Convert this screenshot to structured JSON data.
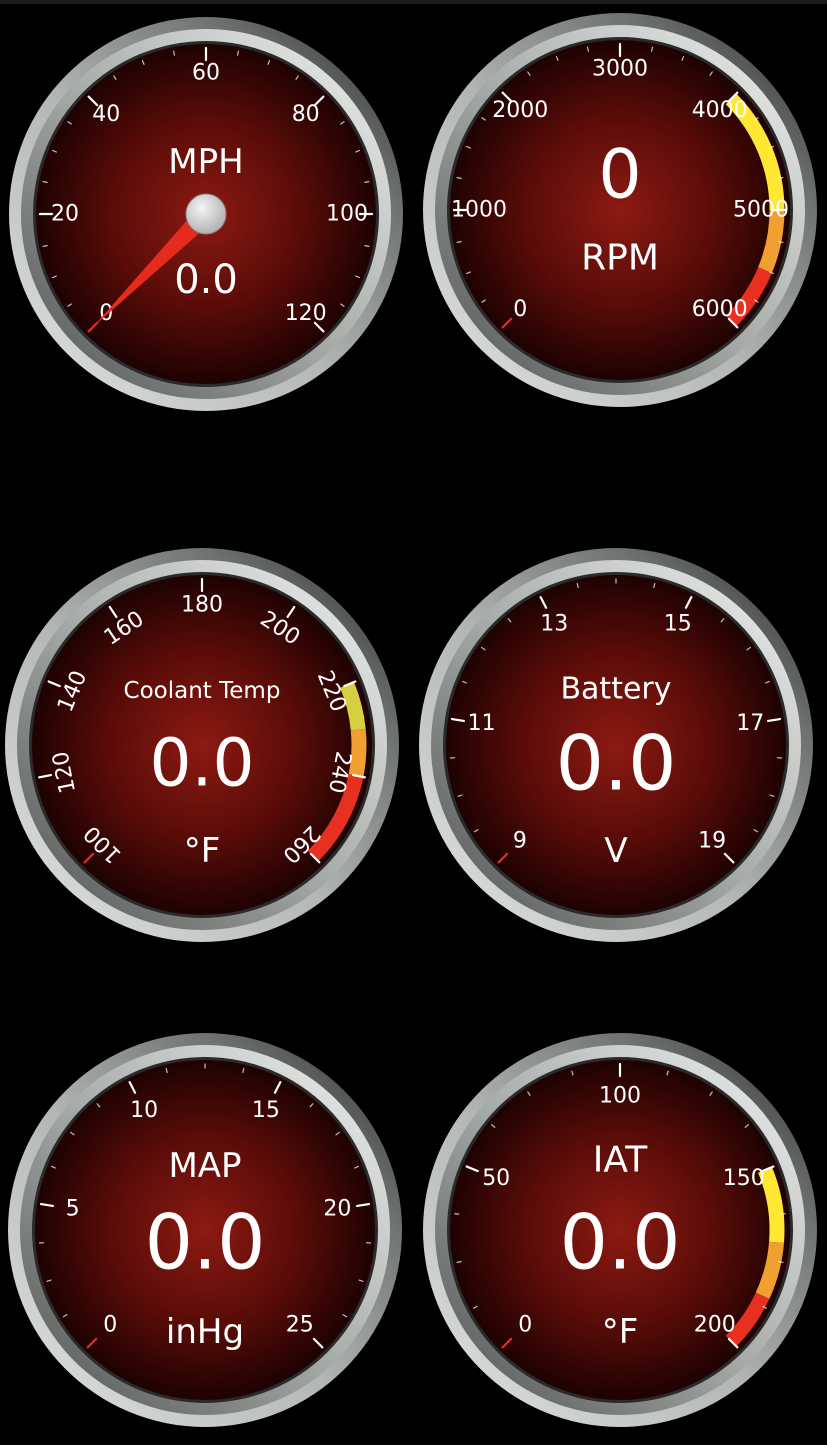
{
  "gauges": [
    {
      "id": "speed",
      "title": "MPH",
      "unit": "",
      "value_text": "0.0",
      "value": 0,
      "min": 0,
      "max": 120,
      "major_ticks": [
        "0",
        "20",
        "40",
        "60",
        "80",
        "100",
        "120"
      ],
      "minor_per_major": 4,
      "has_needle": true,
      "zones": []
    },
    {
      "id": "rpm",
      "title": "RPM",
      "unit": "",
      "value_text": "0",
      "value": 0,
      "min": 0,
      "max": 6000,
      "major_ticks": [
        "0",
        "1000",
        "2000",
        "3000",
        "4000",
        "5000",
        "6000"
      ],
      "minor_per_major": 4,
      "has_needle": false,
      "zones": [
        {
          "from": 4000,
          "to": 5000,
          "color": "#ffe733"
        },
        {
          "from": 5000,
          "to": 5500,
          "color": "#f0a030"
        },
        {
          "from": 5500,
          "to": 6000,
          "color": "#e83020"
        }
      ]
    },
    {
      "id": "coolant",
      "title": "Coolant Temp",
      "unit": "°F",
      "value_text": "0.0",
      "value": 0,
      "min": 100,
      "max": 260,
      "major_ticks": [
        "100",
        "120",
        "140",
        "160",
        "180",
        "200",
        "220",
        "240",
        "260"
      ],
      "minor_per_major": 1,
      "has_needle": false,
      "zones": [
        {
          "from": 220,
          "to": 230,
          "color": "#d4d040"
        },
        {
          "from": 230,
          "to": 240,
          "color": "#f0a030"
        },
        {
          "from": 240,
          "to": 260,
          "color": "#e83020"
        }
      ]
    },
    {
      "id": "battery",
      "title": "Battery",
      "unit": "V",
      "value_text": "0.0",
      "value": 0,
      "min": 9,
      "max": 19,
      "major_ticks": [
        "9",
        "11",
        "13",
        "15",
        "17",
        "19"
      ],
      "minor_per_major": 4,
      "has_needle": false,
      "zones": []
    },
    {
      "id": "map",
      "title": "MAP",
      "unit": "inHg",
      "value_text": "0.0",
      "value": 0,
      "min": 0,
      "max": 25,
      "major_ticks": [
        "0",
        "5",
        "10",
        "15",
        "20",
        "25"
      ],
      "minor_per_major": 4,
      "has_needle": false,
      "zones": []
    },
    {
      "id": "iat",
      "title": "IAT",
      "unit": "°F",
      "value_text": "0.0",
      "value": 0,
      "min": 0,
      "max": 200,
      "major_ticks": [
        "0",
        "50",
        "100",
        "150",
        "200"
      ],
      "minor_per_major": 4,
      "has_needle": false,
      "zones": [
        {
          "from": 150,
          "to": 170,
          "color": "#ffe733"
        },
        {
          "from": 170,
          "to": 185,
          "color": "#f0a030"
        },
        {
          "from": 185,
          "to": 200,
          "color": "#e83020"
        }
      ]
    }
  ],
  "colors": {
    "background": "#000000",
    "dial_center": "#8c1a12",
    "dial_edge": "#1e0202",
    "bezel_light": "#d6d9d6",
    "bezel_dark": "#3a3d3b",
    "needle": "#e52a1e",
    "tick": "#ffffff",
    "zero_tick": "#e0302a"
  }
}
